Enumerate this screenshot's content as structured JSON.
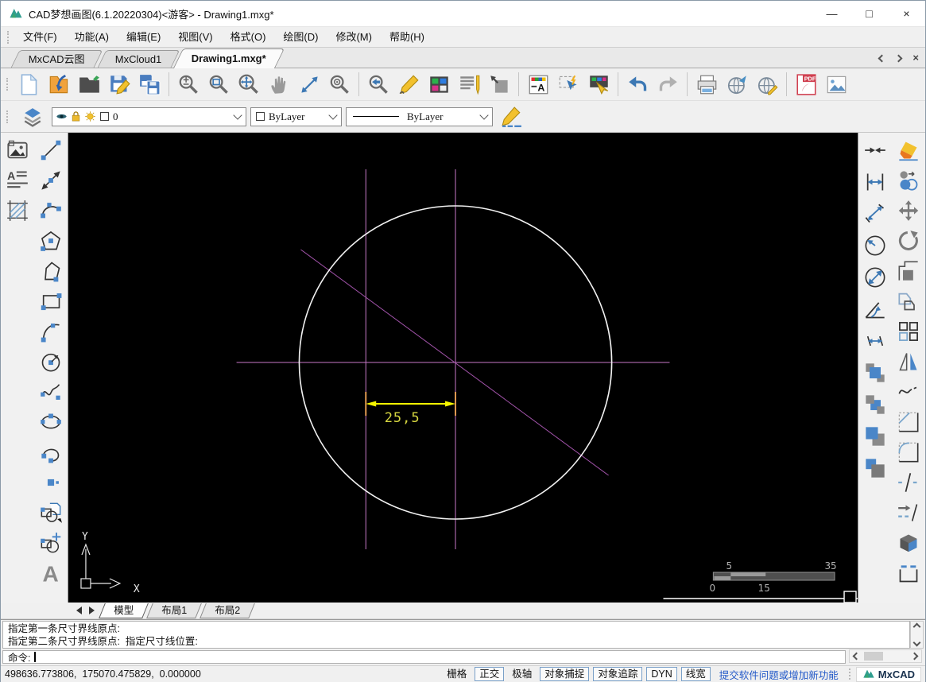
{
  "window": {
    "title": "CAD梦想画图(6.1.20220304)<游客> - Drawing1.mxg*",
    "controls": {
      "minimize": "—",
      "maximize": "□",
      "close": "×"
    }
  },
  "menu": {
    "items": [
      "文件(F)",
      "功能(A)",
      "编辑(E)",
      "视图(V)",
      "格式(O)",
      "绘图(D)",
      "修改(M)",
      "帮助(H)"
    ]
  },
  "doc_tabs": {
    "tabs": [
      "MxCAD云图",
      "MxCloud1",
      "Drawing1.mxg*"
    ],
    "active_index": 2
  },
  "toolbars": {
    "main": [
      "new-file",
      "open-drawing",
      "open-folder",
      "save",
      "save-as",
      "|",
      "zoom-scale",
      "zoom-window",
      "zoom-extents",
      "pan",
      "move-scale",
      "zoom-center",
      "|",
      "zoom-previous",
      "draw-sketch",
      "color-palette",
      "text-content",
      "viewport-clip",
      "|",
      "text-style",
      "quick-select",
      "gesture-config",
      "|",
      "undo",
      "redo",
      "|",
      "print",
      "web-publish",
      "web-sync",
      "|",
      "export-pdf",
      "export-image"
    ],
    "left_col1": [
      "insert-image",
      "text-format",
      "hatch"
    ],
    "left_col2": [
      "line",
      "xline",
      "polyline",
      "polygon",
      "polygon-irregular",
      "rectangle",
      "arc",
      "circle",
      "spline",
      "ellipse",
      "arc-continue",
      "point",
      "block-insert",
      "block-create",
      "text"
    ],
    "right_col1": [
      "dim-shorten",
      "dim-linear",
      "dim-aligned",
      "dim-radius",
      "dim-diameter",
      "dim-angular",
      "dim-continue",
      "draworder-front",
      "draworder-back",
      "draworder-above",
      "draworder-below"
    ],
    "right_col2": [
      "erase",
      "copy",
      "move",
      "rotate",
      "scale",
      "offset",
      "array",
      "mirror",
      "edit-spline",
      "chamfer",
      "fillet",
      "break",
      "lengthen",
      "explode",
      "stretch"
    ]
  },
  "props": {
    "layer": "0",
    "color": "ByLayer",
    "linetype": "ByLayer"
  },
  "drawing": {
    "dim_text": "25,5",
    "ucs": {
      "x": "X",
      "y": "Y"
    },
    "scale_bar": {
      "t1": "5",
      "t2": "35",
      "b1": "0",
      "b2": "15"
    }
  },
  "layout_tabs": {
    "tabs": [
      "模型",
      "布局1",
      "布局2"
    ],
    "active_index": 0
  },
  "command": {
    "history_line1": "指定第一条尺寸界线原点:",
    "history_line2": "指定第二条尺寸界线原点:  指定尺寸线位置:",
    "prompt": "命令:"
  },
  "status": {
    "coordinates": "498636.773806,  175070.475829,  0.000000",
    "toggles": [
      {
        "label": "栅格",
        "boxed": false
      },
      {
        "label": "正交",
        "boxed": true
      },
      {
        "label": "极轴",
        "boxed": false
      },
      {
        "label": "对象捕捉",
        "boxed": true
      },
      {
        "label": "对象追踪",
        "boxed": true
      },
      {
        "label": "DYN",
        "boxed": true
      },
      {
        "label": "线宽",
        "boxed": true
      }
    ],
    "link": "提交软件问题或增加新功能",
    "brand": "MxCAD"
  },
  "colors": {
    "accent_blue": "#3c78b4",
    "construction_magenta": "#c878c8",
    "dim_yellow": "#f5f500",
    "canvas_black": "#000000",
    "link_blue": "#2158c8"
  }
}
